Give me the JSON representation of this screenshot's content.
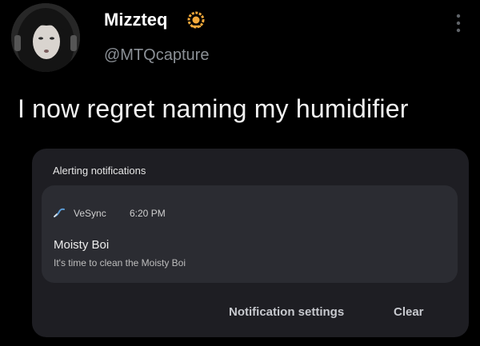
{
  "tweet": {
    "author": {
      "display_name": "Mizzteq",
      "handle": "@MTQcapture",
      "badge_icon": "sunflower-icon"
    },
    "text": "I now regret naming my humidifier",
    "menu_icon": "more-vertical-icon"
  },
  "screenshot": {
    "panel_header": "Alerting notifications",
    "notification": {
      "app_icon": "vesync-app-icon",
      "app_name": "VeSync",
      "time": "6:20 PM",
      "title": "Moisty Boi",
      "body": "It's time to clean the Moisty Boi"
    },
    "actions": {
      "settings_label": "Notification settings",
      "clear_label": "Clear"
    }
  },
  "colors": {
    "background": "#000000",
    "handle": "#8b9096",
    "panel": "#1e1e23",
    "card": "#2b2c32",
    "badge": "#f2a93b"
  }
}
